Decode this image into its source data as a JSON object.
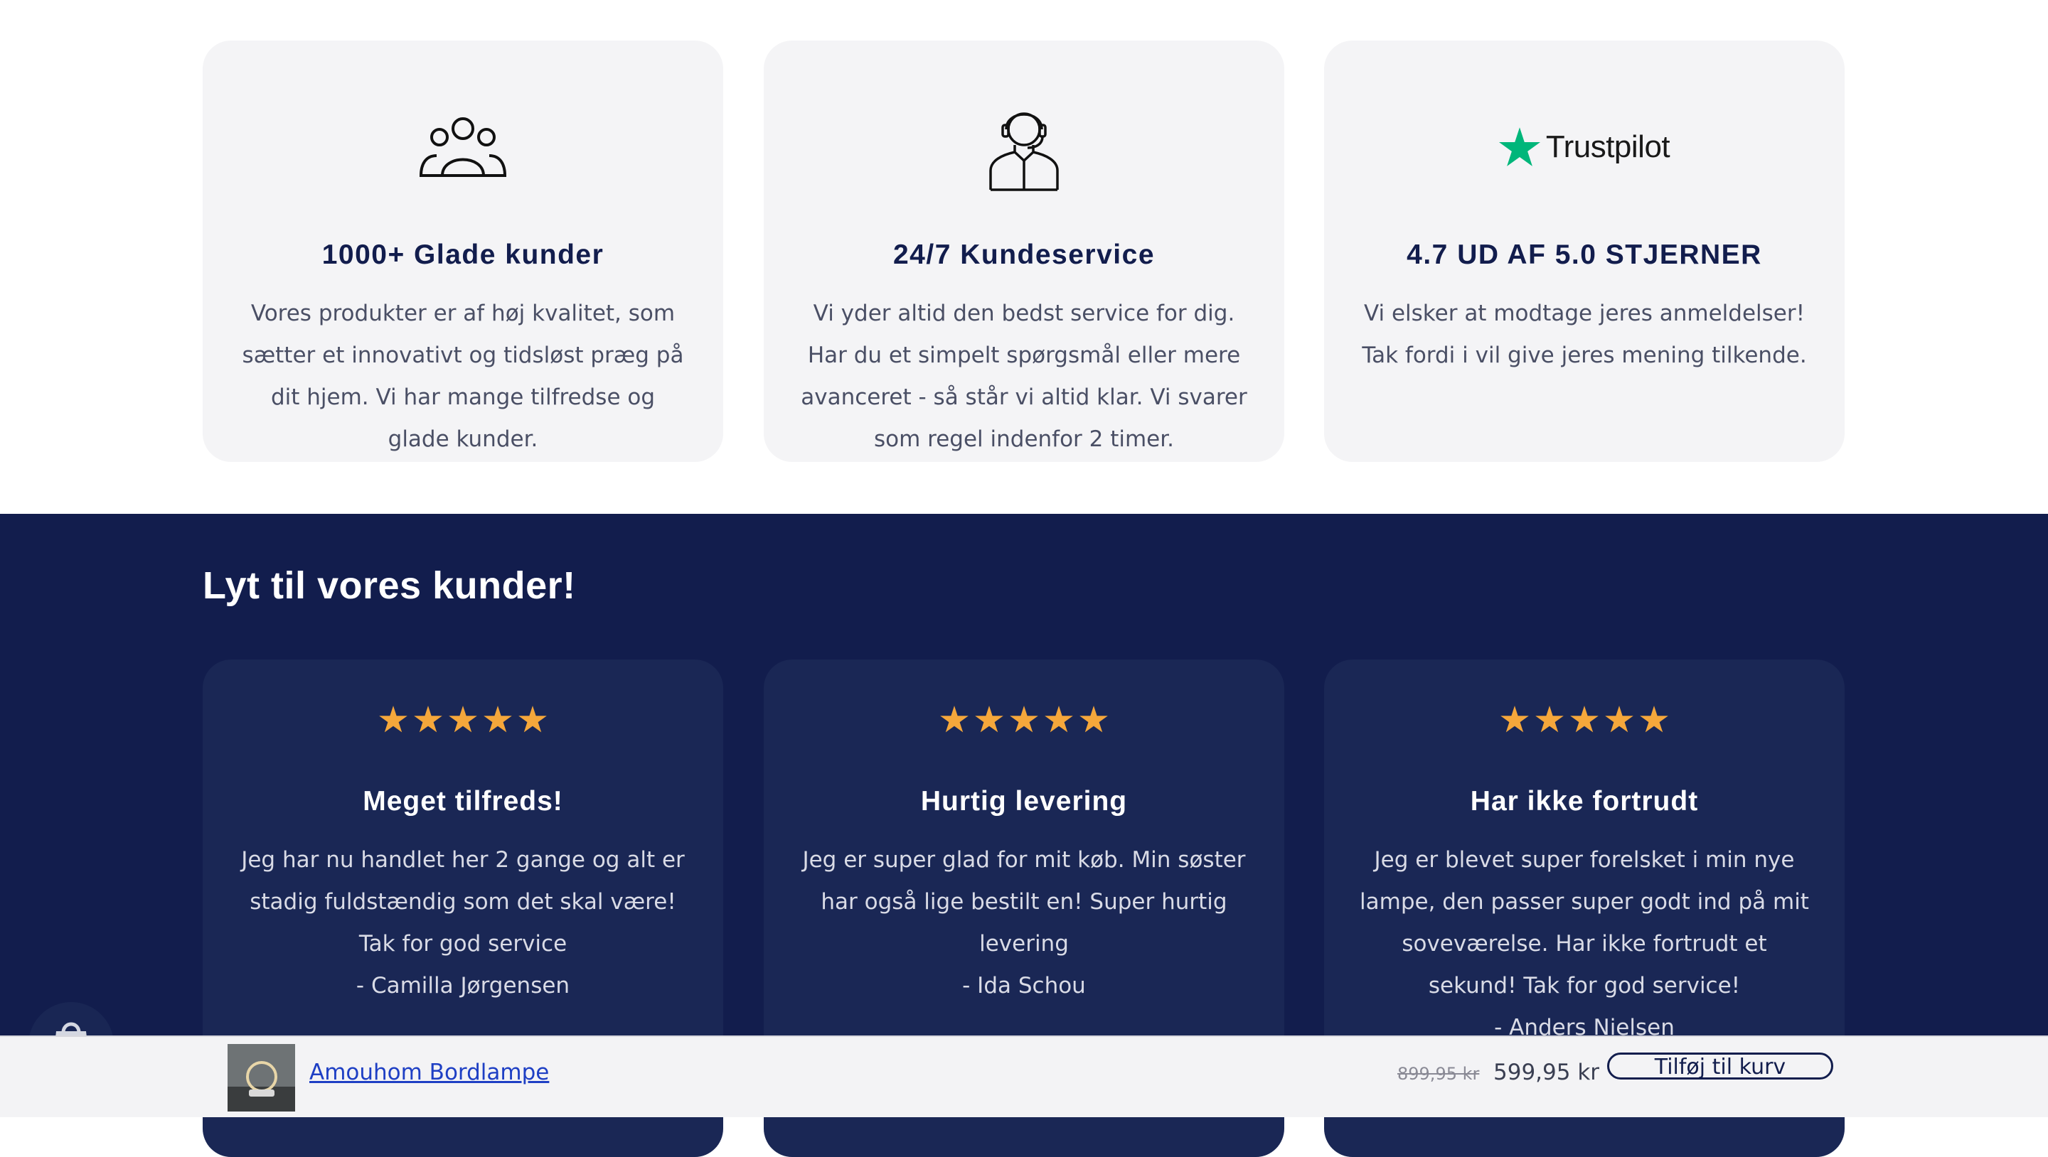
{
  "features": [
    {
      "icon": "customers-group-icon",
      "title": "1000+ Glade kunder",
      "text": "Vores produkter er af høj kvalitet, som sætter et innovativt og tidsløst præg på dit hjem. Vi har mange tilfredse og glade kunder."
    },
    {
      "icon": "headset-agent-icon",
      "title": "24/7 Kundeservice",
      "text": "Vi yder altid den bedst service for dig. Har du et simpelt spørgsmål eller mere avanceret - så står vi altid klar. Vi svarer som regel indenfor 2 timer."
    },
    {
      "icon": "trustpilot-logo",
      "logo_text": "Trustpilot",
      "title": "4.7 UD AF 5.0 STJERNER",
      "text": "Vi elsker at modtage jeres anmeldelser! Tak fordi i vil give jeres mening tilkende."
    }
  ],
  "reviews_section": {
    "heading": "Lyt til vores kunder!",
    "star_color": "#f5a73b",
    "reviews": [
      {
        "rating": 5,
        "title": "Meget tilfreds!",
        "text": "Jeg har nu handlet her 2 gange og alt er stadig fuldstændig som det skal være! Tak for god service",
        "author": "- Camilla Jørgensen"
      },
      {
        "rating": 5,
        "title": "Hurtig levering",
        "text": "Jeg er super glad for mit køb. Min søster har også lige bestilt en! Super hurtig levering",
        "author": "- Ida Schou"
      },
      {
        "rating": 5,
        "title": "Har ikke fortrudt",
        "text": "Jeg er blevet super forelsket i min nye lampe, den passer super godt ind på mit soveværelse. Har ikke fortrudt et sekund! Tak for god service!",
        "author": "- Anders Nielsen"
      }
    ]
  },
  "sticky_cart": {
    "product_name": "Amouhom Bordlampe",
    "old_price": "899,95 kr",
    "price": "599,95 kr",
    "button_label": "Tilføj til kurv"
  },
  "colors": {
    "navy": "#121d4d",
    "card_light": "#f4f4f6",
    "card_dark": "#1a2755",
    "trustpilot_green": "#00b67a"
  }
}
